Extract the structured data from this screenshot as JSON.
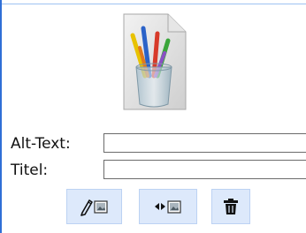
{
  "fields": {
    "alt_text_label": "Alt-Text:",
    "alt_text_value": "",
    "title_label": "Titel:",
    "title_value": ""
  },
  "icons": {
    "thumbnail": "document-paintbrushes-icon",
    "edit": "pencil-image-icon",
    "replace": "arrows-image-icon",
    "delete": "trash-icon"
  },
  "colors": {
    "accent_border": "#2f6fd6",
    "button_bg": "#dde9fb"
  }
}
